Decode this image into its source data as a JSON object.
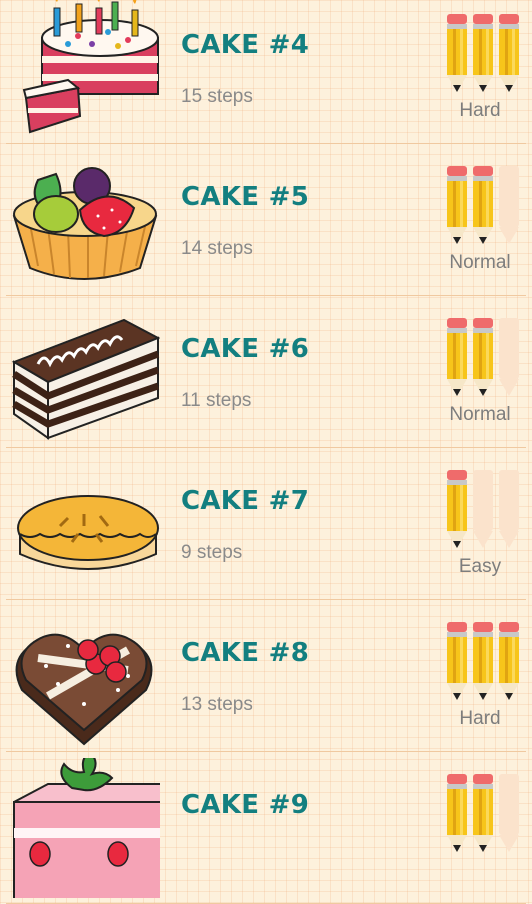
{
  "cakes": [
    {
      "title": "CAKE #4",
      "steps": "15 steps",
      "difficulty": "Hard",
      "level": 3,
      "art": "birthday-cake"
    },
    {
      "title": "CAKE #5",
      "steps": "14 steps",
      "difficulty": "Normal",
      "level": 2,
      "art": "fruit-tart"
    },
    {
      "title": "CAKE #6",
      "steps": "11 steps",
      "difficulty": "Normal",
      "level": 2,
      "art": "chocolate-slice"
    },
    {
      "title": "CAKE #7",
      "steps": "9 steps",
      "difficulty": "Easy",
      "level": 1,
      "art": "pie"
    },
    {
      "title": "CAKE #8",
      "steps": "13 steps",
      "difficulty": "Hard",
      "level": 3,
      "art": "heart-cake"
    },
    {
      "title": "CAKE #9",
      "steps": "",
      "difficulty": "",
      "level": 2,
      "art": "strawberry-cake"
    }
  ],
  "colors": {
    "title": "#137f80",
    "pencil_active": "#f7c51a",
    "pencil_inactive": "#fbe3cc"
  }
}
